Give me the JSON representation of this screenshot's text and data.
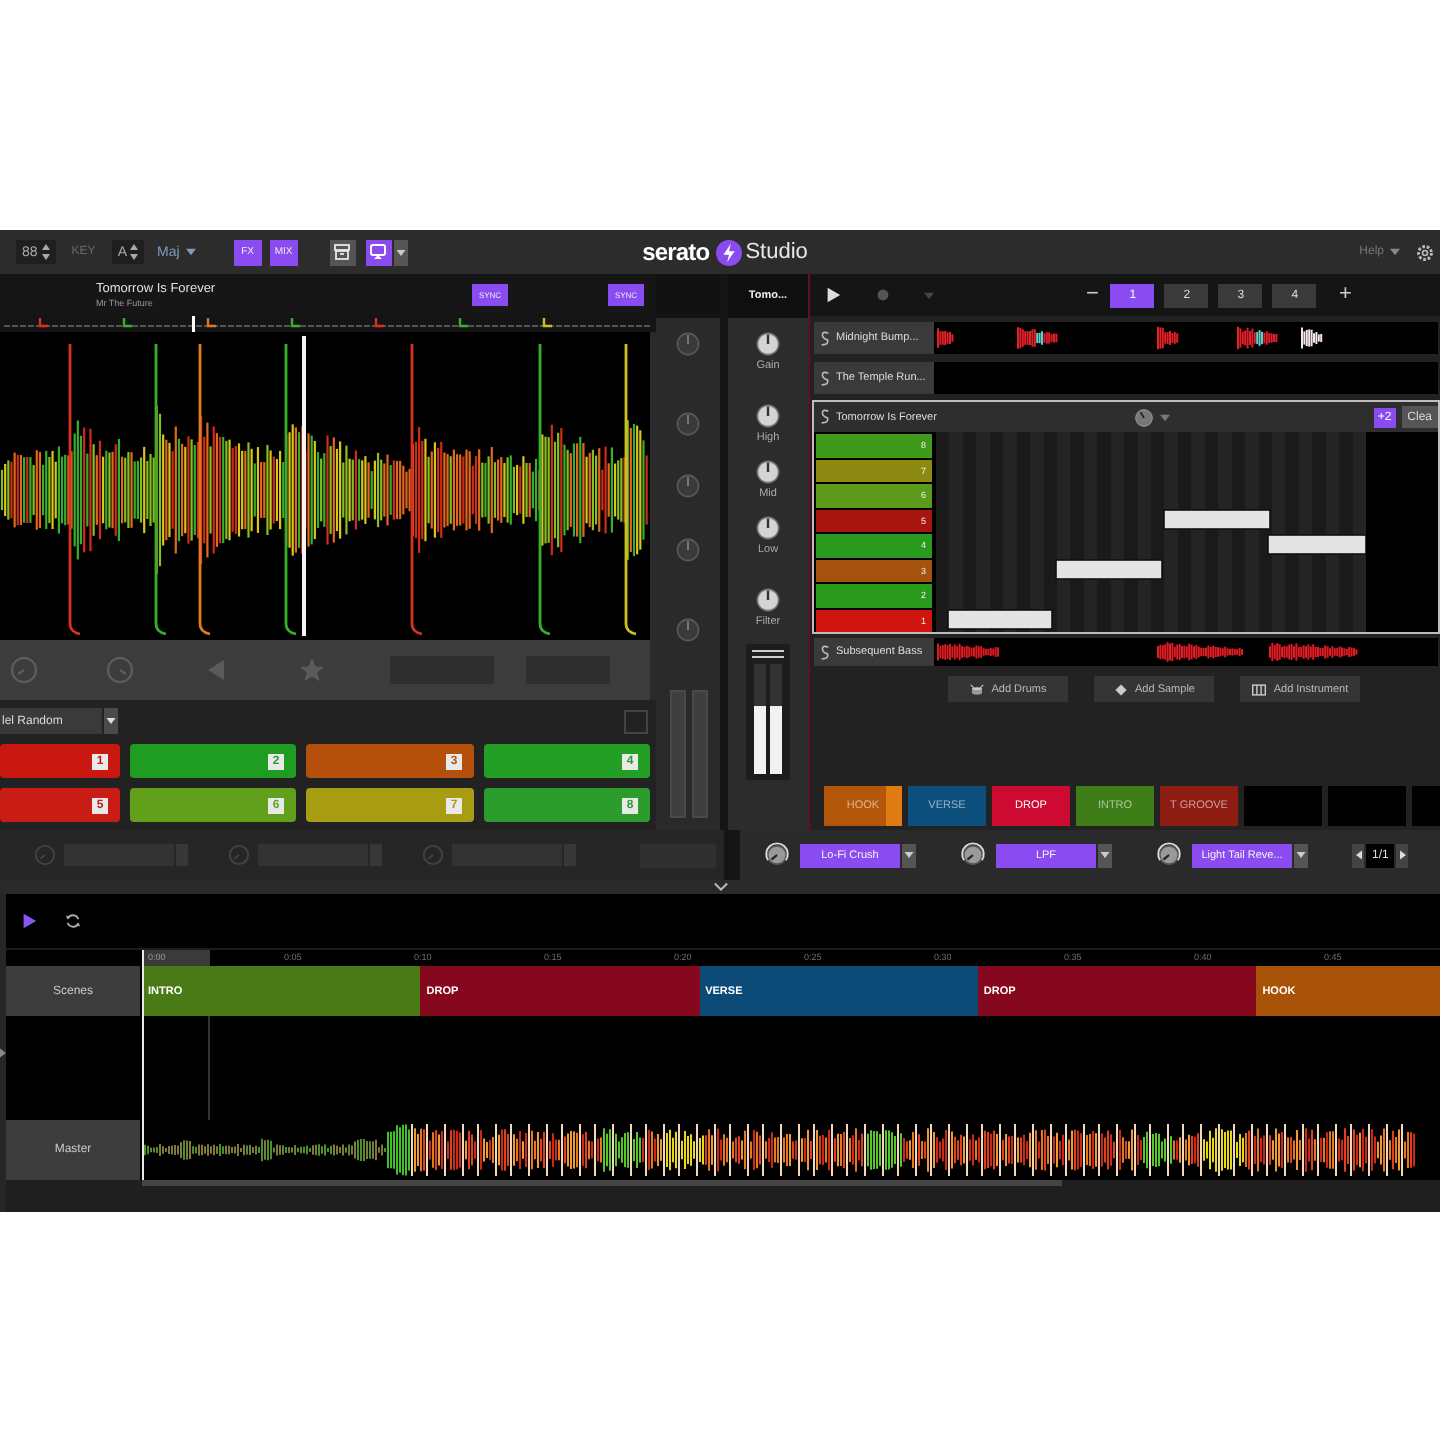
{
  "top_bar": {
    "bpm": "88",
    "key_label": "KEY",
    "key": "A",
    "scale": "Maj",
    "view_buttons": [
      {
        "label": "FX",
        "selected": true
      },
      {
        "label": "MIX",
        "selected": true
      }
    ],
    "icon_buttons": [
      {
        "kind": "archive",
        "selected": false
      },
      {
        "kind": "display",
        "selected": true
      }
    ],
    "brand": "serato",
    "product": "Studio",
    "help": "Help"
  },
  "deck": {
    "title": "Tomorrow Is Forever",
    "artist": "Mr The Future",
    "sync_buttons": [
      "SYNC",
      "SYNC"
    ],
    "cues": [
      {
        "color": "#d2321e"
      },
      {
        "color": "#34b02c"
      },
      {
        "color": "#e07a1c"
      },
      {
        "color": "#34b02c"
      },
      {
        "color": "#d2321e"
      },
      {
        "color": "#34b02c"
      },
      {
        "color": "#c9c21e"
      }
    ]
  },
  "pads": {
    "mode": "lel Random",
    "items": [
      {
        "label": "1",
        "color": "#c8180f"
      },
      {
        "label": "2",
        "color": "#1f9d22"
      },
      {
        "label": "3",
        "color": "#b4500c"
      },
      {
        "label": "4",
        "color": "#239f25"
      },
      {
        "label": "5",
        "color": "#c81c14"
      },
      {
        "label": "6",
        "color": "#62a01c"
      },
      {
        "label": "7",
        "color": "#a89c12"
      },
      {
        "label": "8",
        "color": "#2c9c2c"
      }
    ]
  },
  "deck_fx_slots": [
    {
      "disabled": true
    },
    {
      "disabled": true
    },
    {
      "disabled": true
    }
  ],
  "mixer": {
    "deck_label": "Tomo...",
    "knobs": [
      {
        "label": "Gain"
      },
      {
        "label": "High"
      },
      {
        "label": "Mid"
      },
      {
        "label": "Low"
      },
      {
        "label": "Filter"
      }
    ],
    "meters": [
      {
        "level": 0.62
      },
      {
        "level": 0.62
      }
    ]
  },
  "sequencer": {
    "minus": "−",
    "plus": "+",
    "patterns": [
      {
        "label": "1",
        "selected": true
      },
      {
        "label": "2",
        "selected": false
      },
      {
        "label": "3",
        "selected": false
      },
      {
        "label": "4",
        "selected": false
      }
    ],
    "tracks": [
      {
        "name": "Midnight Bump...",
        "kind": "audio",
        "selected": false
      },
      {
        "name": "The Temple Run...",
        "kind": "audio",
        "selected": false
      },
      {
        "name": "Tomorrow Is Forever",
        "kind": "sampler",
        "selected": true,
        "transpose": "+2",
        "clear": "Clea",
        "pads": [
          {
            "label": "8",
            "color": "#3f9a1c"
          },
          {
            "label": "7",
            "color": "#8c8a12"
          },
          {
            "label": "6",
            "color": "#5c9a1c"
          },
          {
            "label": "5",
            "color": "#a8140e"
          },
          {
            "label": "4",
            "color": "#2a9a1e"
          },
          {
            "label": "3",
            "color": "#a4520e"
          },
          {
            "label": "2",
            "color": "#2a9a1e"
          },
          {
            "label": "1",
            "color": "#d0140e"
          }
        ]
      },
      {
        "name": "Subsequent Bass",
        "kind": "audio",
        "selected": false
      }
    ],
    "add_buttons": [
      "Add Drums",
      "Add Sample",
      "Add Instrument"
    ],
    "scenes": [
      {
        "kind": "scene",
        "label": "HOOK",
        "color": "#b3560a",
        "selected": false,
        "playing": true
      },
      {
        "kind": "scene",
        "label": "VERSE",
        "color": "#0d4f7c",
        "selected": false,
        "playing": false
      },
      {
        "kind": "scene",
        "label": "DROP",
        "color": "#cc0a32",
        "selected": true,
        "playing": false
      },
      {
        "kind": "scene",
        "label": "INTRO",
        "color": "#3f7d18",
        "selected": false,
        "playing": false
      },
      {
        "kind": "scene",
        "label": "T GROOVE",
        "color": "#8e1c12",
        "selected": false,
        "playing": false
      },
      {
        "kind": "empty",
        "selected": false,
        "playing": false
      },
      {
        "kind": "empty",
        "selected": false,
        "playing": false
      },
      {
        "kind": "empty",
        "selected": false,
        "playing": false
      }
    ]
  },
  "fx": {
    "slots": [
      {
        "name": "Lo-Fi Crush"
      },
      {
        "name": "LPF"
      },
      {
        "name": "Light Tail Reve..."
      }
    ],
    "page": "1/1"
  },
  "arrangement": {
    "ruler": [
      "0:00",
      "0:05",
      "0:10",
      "0:15",
      "0:20",
      "0:25",
      "0:30",
      "0:35",
      "0:40",
      "0:45"
    ],
    "scenes_label": "Scenes",
    "master_label": "Master",
    "scenes": [
      {
        "label": "INTRO",
        "color": "#4a7a16"
      },
      {
        "label": "DROP",
        "color": "#86081f"
      },
      {
        "label": "VERSE",
        "color": "#0c4b78"
      },
      {
        "label": "DROP",
        "color": "#86081f"
      },
      {
        "label": "HOOK",
        "color": "#a85208"
      }
    ]
  }
}
